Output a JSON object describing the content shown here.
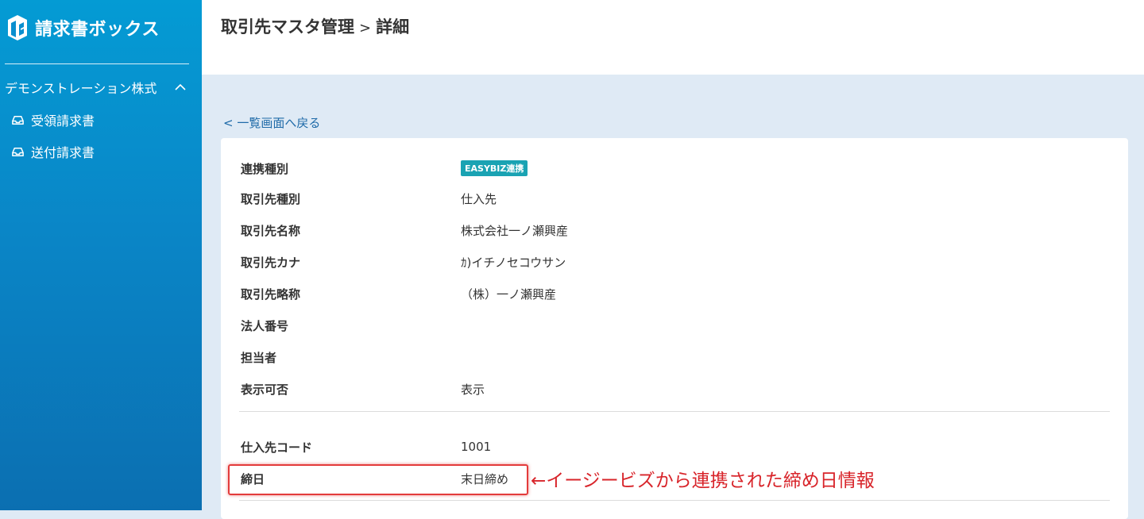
{
  "sidebar": {
    "brand": "請求書ボックス",
    "company": "デモンストレーション株式",
    "items": [
      {
        "label": "受領請求書"
      },
      {
        "label": "送付請求書"
      }
    ]
  },
  "header": {
    "title": "取引先マスタ管理",
    "separator": ">",
    "subtitle": "詳細"
  },
  "back_link": "< 一覧画面へ戻る",
  "details": [
    {
      "label": "連携種別",
      "badge": "EASYBIZ連携"
    },
    {
      "label": "取引先種別",
      "value": "仕入先"
    },
    {
      "label": "取引先名称",
      "value": "株式会社一ノ瀬興産"
    },
    {
      "label": "取引先カナ",
      "value": "ｶ)イチノセコウサン"
    },
    {
      "label": "取引先略称",
      "value": "（株）一ノ瀬興産"
    },
    {
      "label": "法人番号",
      "value": ""
    },
    {
      "label": "担当者",
      "value": ""
    },
    {
      "label": "表示可否",
      "value": "表示"
    }
  ],
  "supplier": [
    {
      "label": "仕入先コード",
      "value": "1001"
    },
    {
      "label": "締日",
      "value": "末日締め"
    }
  ],
  "annotation": "←イージービズから連携された締め日情報",
  "colors": {
    "sidebar_top": "#049bd4",
    "sidebar_bottom": "#0b6fb1",
    "badge": "#1aa3b3",
    "link": "#1e6aa8",
    "annotation": "#d8242a",
    "page_bg": "#dfeaf5"
  }
}
